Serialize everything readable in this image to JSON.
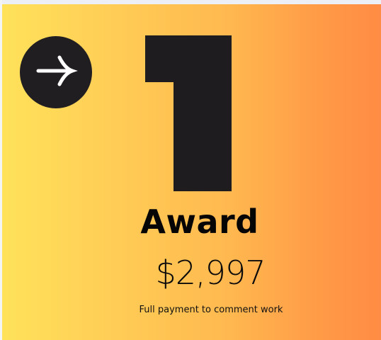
{
  "card": {
    "rank": "1",
    "title": "Award",
    "price": "$2,997",
    "caption": "Full payment to comment work",
    "icon": "arrow-right-icon",
    "colors": {
      "gradient_start": "#ffe25a",
      "gradient_end": "#ff8c44",
      "dark": "#211e22"
    }
  }
}
